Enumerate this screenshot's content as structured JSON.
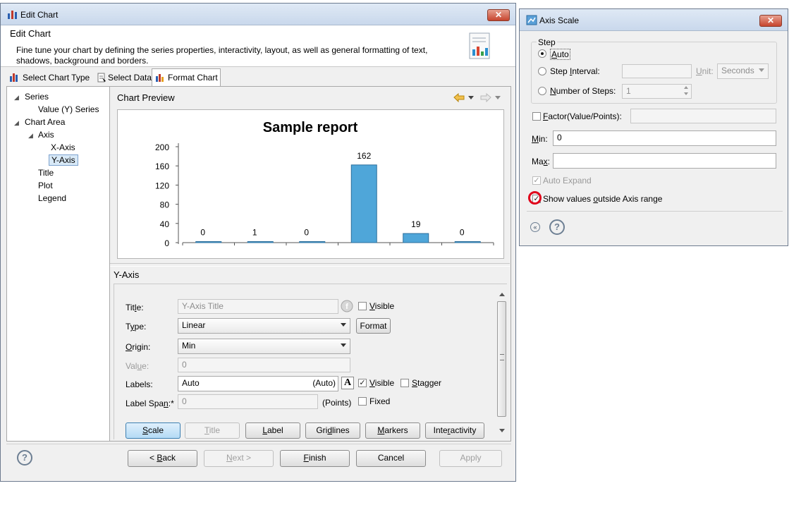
{
  "edit_chart": {
    "window_title": "Edit Chart",
    "header_title": "Edit Chart",
    "description": "Fine tune your chart by defining the series properties, interactivity, layout, as well as general formatting of text, shadows, background and borders.",
    "tabs": [
      "Select Chart Type",
      "Select Data",
      "Format Chart"
    ],
    "tree": [
      "Series",
      "Value (Y) Series",
      "Chart Area",
      "Axis",
      "X-Axis",
      "Y-Axis",
      "Title",
      "Plot",
      "Legend"
    ],
    "preview_label": "Chart Preview",
    "section_title": "Y-Axis",
    "form": {
      "title_label": "Title:",
      "title_placeholder": "Y-Axis Title",
      "visible_label": "Visible",
      "type_label": "Type:",
      "type_value": "Linear",
      "format_button": "Format",
      "origin_label": "Origin:",
      "origin_value": "Min",
      "value_label": "Value:",
      "value_value": "0",
      "labels_label": "Labels:",
      "labels_value": "Auto",
      "labels_auto": "(Auto)",
      "labels_visible": "Visible",
      "stagger_label": "Stagger",
      "label_span_label": "Label Span:*",
      "label_span_value": "0",
      "points_label": "(Points)",
      "fixed_label": "Fixed"
    },
    "axis_buttons": [
      "Scale",
      "Title",
      "Label",
      "Gridlines",
      "Markers",
      "Interactivity"
    ],
    "footer_buttons": [
      "< Back",
      "Next >",
      "Finish",
      "Cancel",
      "Apply"
    ]
  },
  "chart_data": {
    "type": "bar",
    "title": "Sample report",
    "values": [
      0,
      1,
      0,
      162,
      19,
      0
    ],
    "y_ticks": [
      0,
      40,
      80,
      120,
      160,
      200
    ],
    "ylim": [
      0,
      200
    ],
    "bar_color": "#4fa6d9"
  },
  "axis_scale": {
    "window_title": "Axis Scale",
    "step_group": "Step",
    "auto": "Auto",
    "step_interval": "Step Interval:",
    "unit_label": "Unit:",
    "unit_value": "Seconds",
    "number_of_steps": "Number of Steps:",
    "number_of_steps_value": "1",
    "factor_label": "Factor(Value/Points):",
    "min_label": "Min:",
    "min_value": "0",
    "max_label": "Max:",
    "max_value": "",
    "auto_expand": "Auto Expand",
    "show_values": "Show values outside Axis range"
  },
  "colors": {
    "accent": "#3c7fb1",
    "highlight_circle": "#e0001a"
  }
}
